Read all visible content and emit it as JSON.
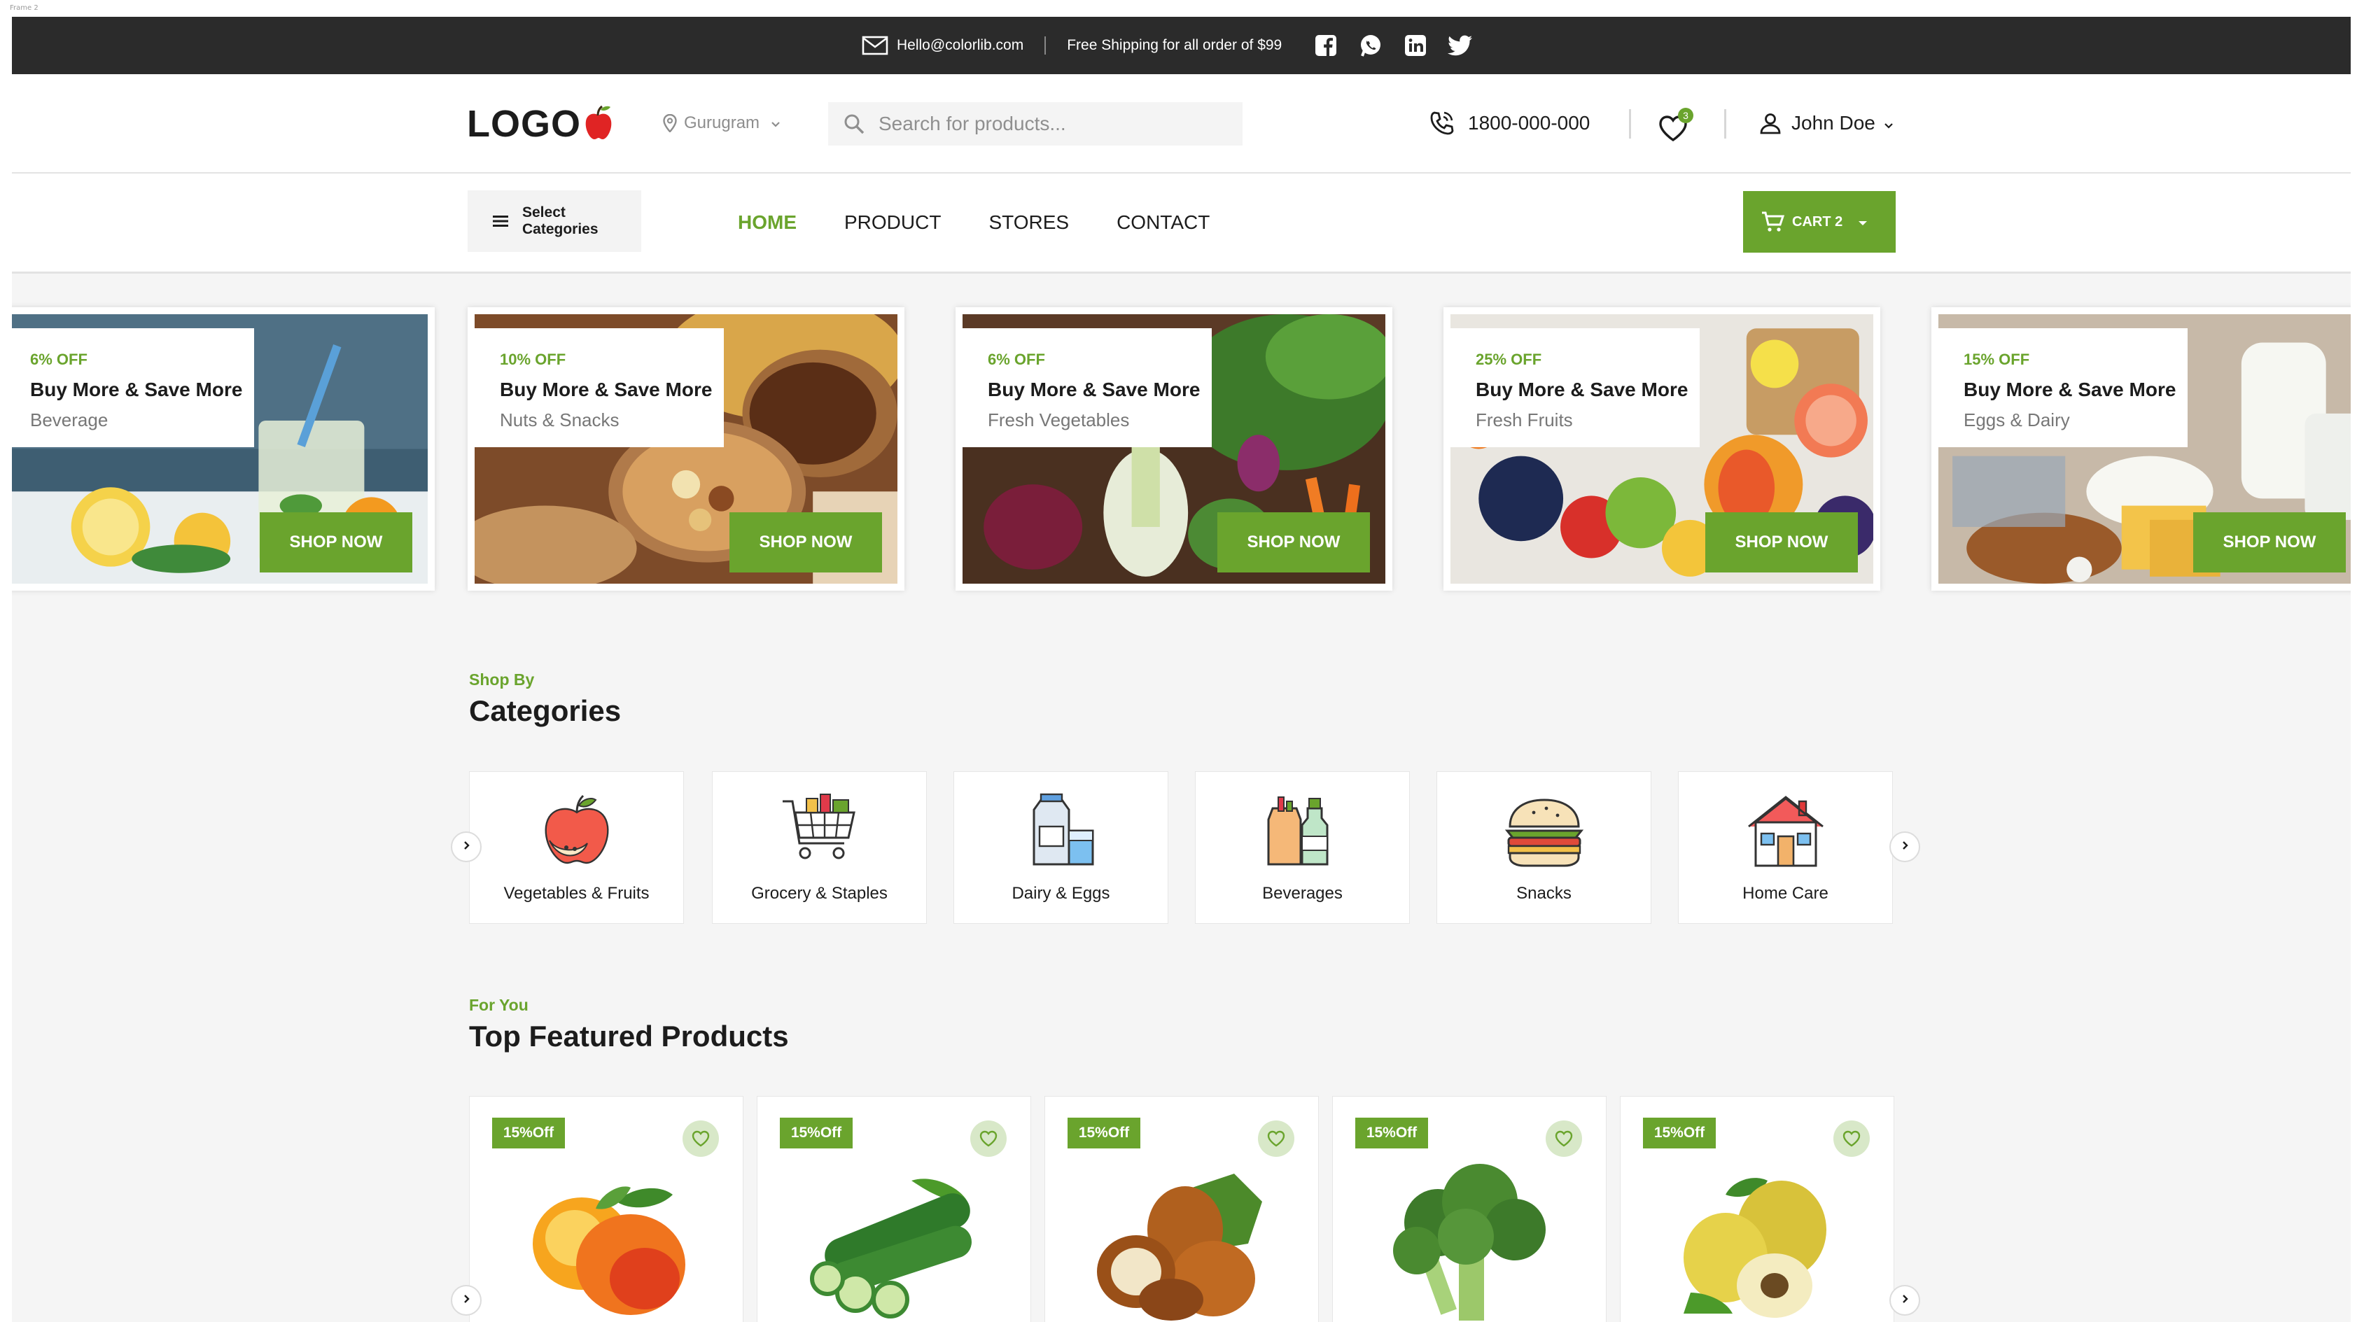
{
  "frame_label": "Frame 2",
  "colors": {
    "accent": "#6aa42d",
    "topbar": "#2b2b2b",
    "page_bg": "#f5f5f5"
  },
  "topbar": {
    "email": "Hello@colorlib.com",
    "shipping": "Free Shipping for all order of $99",
    "social_icons": [
      "facebook-icon",
      "whatsapp-icon",
      "linkedin-icon",
      "twitter-icon"
    ]
  },
  "header": {
    "logo": "LOGO",
    "location": "Gurugram",
    "search_placeholder": "Search for products...",
    "phone": "1800-000-000",
    "wishlist_count": "3",
    "user_name": "John Doe"
  },
  "nav": {
    "categories_button": "Select Categories",
    "menu": [
      "HOME",
      "PRODUCT",
      "STORES",
      "CONTACT"
    ],
    "active": "HOME",
    "cart_label": "CART 2"
  },
  "banners": [
    {
      "off": "6% OFF",
      "headline": "Buy More & Save More",
      "category": "Beverage",
      "button": "SHOP NOW"
    },
    {
      "off": "10% OFF",
      "headline": "Buy More & Save More",
      "category": "Nuts & Snacks",
      "button": "SHOP NOW"
    },
    {
      "off": "6% OFF",
      "headline": "Buy More & Save More",
      "category": "Fresh Vegetables",
      "button": "SHOP NOW"
    },
    {
      "off": "25% OFF",
      "headline": "Buy More & Save More",
      "category": "Fresh Fruits",
      "button": "SHOP NOW"
    },
    {
      "off": "15% OFF",
      "headline": "Buy More & Save More",
      "category": "Eggs & Dairy",
      "button": "SHOP NOW"
    }
  ],
  "categories_section": {
    "kicker": "Shop By",
    "title": "Categories",
    "items": [
      {
        "label": "Vegetables & Fruits",
        "icon": "apple-icon"
      },
      {
        "label": "Grocery & Staples",
        "icon": "shopping-cart-icon"
      },
      {
        "label": "Dairy & Eggs",
        "icon": "milk-icon"
      },
      {
        "label": "Beverages",
        "icon": "bottles-icon"
      },
      {
        "label": "Snacks",
        "icon": "burger-icon"
      },
      {
        "label": "Home Care",
        "icon": "house-icon"
      }
    ]
  },
  "featured_section": {
    "kicker": "For You",
    "title": "Top Featured Products",
    "products": [
      {
        "badge": "15%Off",
        "image": "apricot"
      },
      {
        "badge": "15%Off",
        "image": "cucumber"
      },
      {
        "badge": "15%Off",
        "image": "hazelnut"
      },
      {
        "badge": "15%Off",
        "image": "broccoli"
      },
      {
        "badge": "15%Off",
        "image": "quince"
      }
    ]
  }
}
